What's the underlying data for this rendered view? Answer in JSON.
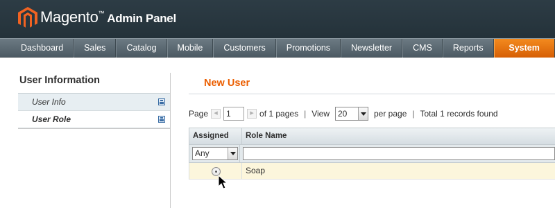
{
  "header": {
    "brand": "Magento",
    "trademark": "™",
    "subtitle": "Admin Panel"
  },
  "nav": {
    "items": [
      "Dashboard",
      "Sales",
      "Catalog",
      "Mobile",
      "Customers",
      "Promotions",
      "Newsletter",
      "CMS",
      "Reports",
      "System"
    ],
    "active": "System",
    "accent_color": "#e8700c"
  },
  "sidebar": {
    "title": "User Information",
    "tabs": [
      {
        "label": "User Info",
        "icon": "save-icon"
      },
      {
        "label": "User Role",
        "icon": "save-icon"
      }
    ]
  },
  "content": {
    "title": "New User",
    "title_color": "#eb5e00"
  },
  "pager": {
    "page_label": "Page",
    "page_value": "1",
    "of_pages": "of 1 pages",
    "view_label": "View",
    "view_value": "20",
    "per_page": "per page",
    "total": "Total 1 records found"
  },
  "grid": {
    "columns": [
      "Assigned",
      "Role Name"
    ],
    "filter": {
      "assigned_value": "Any",
      "role_value": ""
    },
    "rows": [
      {
        "assigned": false,
        "role_name": "Soap"
      }
    ]
  }
}
